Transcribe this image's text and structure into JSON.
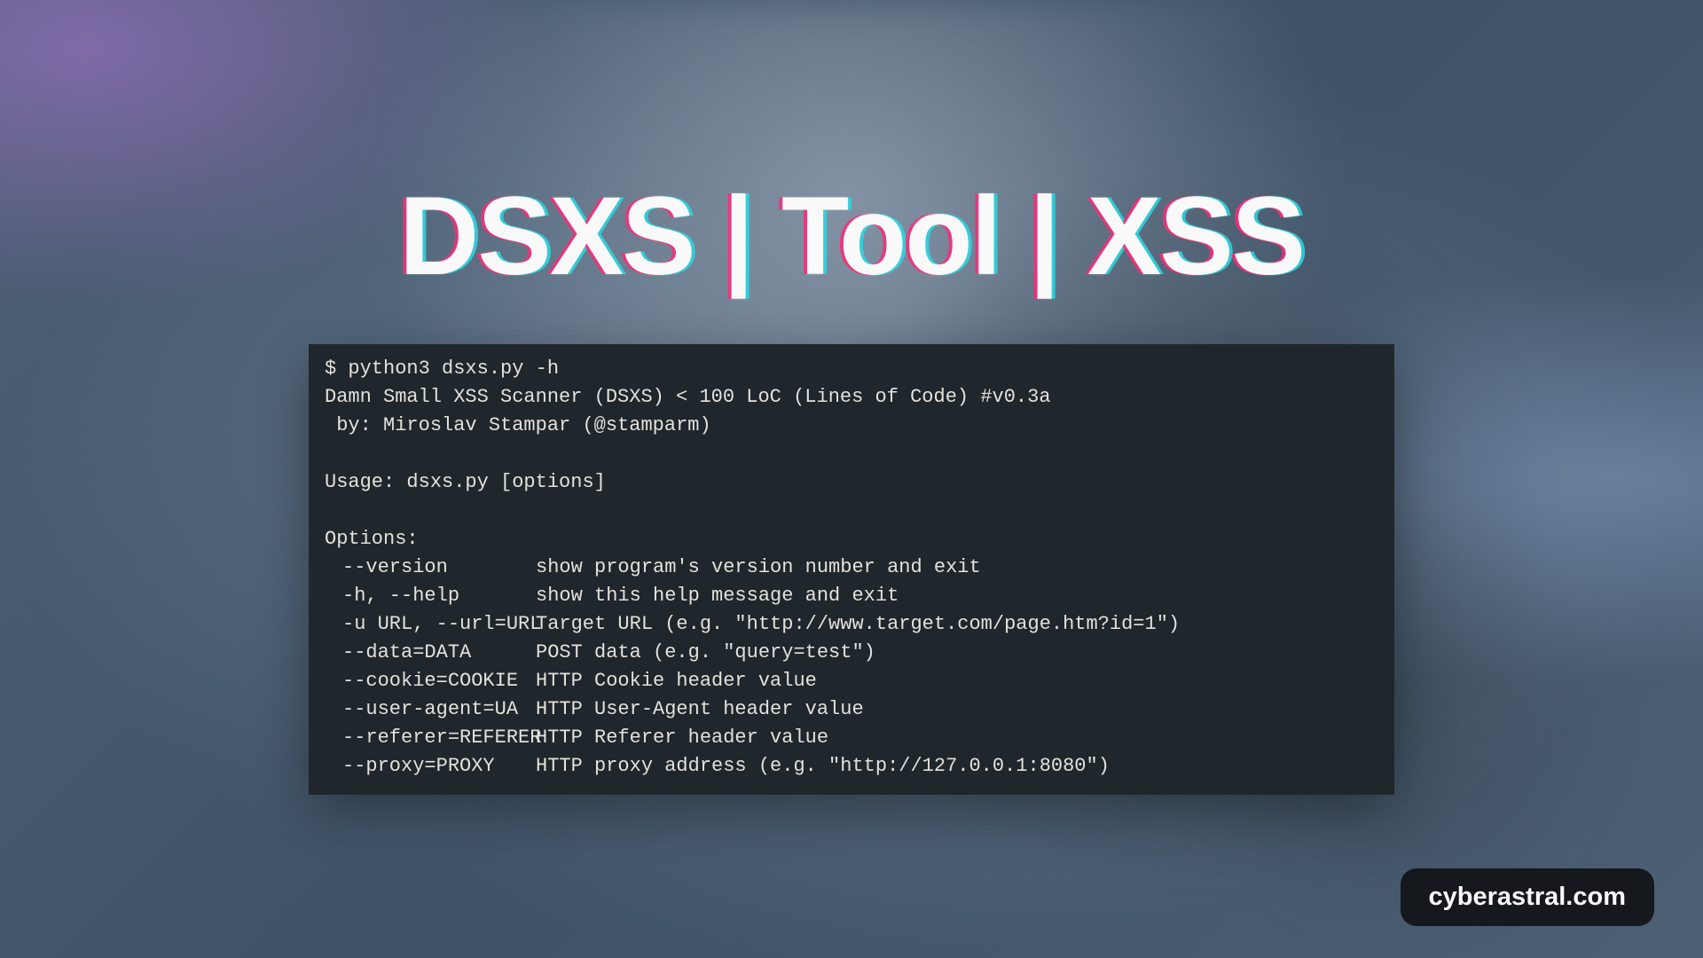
{
  "title": "DSXS | Tool | XSS",
  "terminal": {
    "command": "$ python3 dsxs.py -h",
    "banner": "Damn Small XSS Scanner (DSXS) < 100 LoC (Lines of Code) #v0.3a",
    "author": " by: Miroslav Stampar (@stamparm)",
    "usage": "Usage: dsxs.py [options]",
    "options_header": "Options:",
    "options": [
      {
        "flag": "--version",
        "desc": "show program's version number and exit"
      },
      {
        "flag": "-h, --help",
        "desc": "show this help message and exit"
      },
      {
        "flag": "-u URL, --url=URL",
        "desc": "Target URL (e.g. \"http://www.target.com/page.htm?id=1\")"
      },
      {
        "flag": "--data=DATA",
        "desc": "POST data (e.g. \"query=test\")"
      },
      {
        "flag": "--cookie=COOKIE",
        "desc": "HTTP Cookie header value"
      },
      {
        "flag": "--user-agent=UA",
        "desc": "HTTP User-Agent header value"
      },
      {
        "flag": "--referer=REFERER",
        "desc": "HTTP Referer header value"
      },
      {
        "flag": "--proxy=PROXY",
        "desc": "HTTP proxy address (e.g. \"http://127.0.0.1:8080\")"
      }
    ]
  },
  "watermark": "cyberastral.com"
}
